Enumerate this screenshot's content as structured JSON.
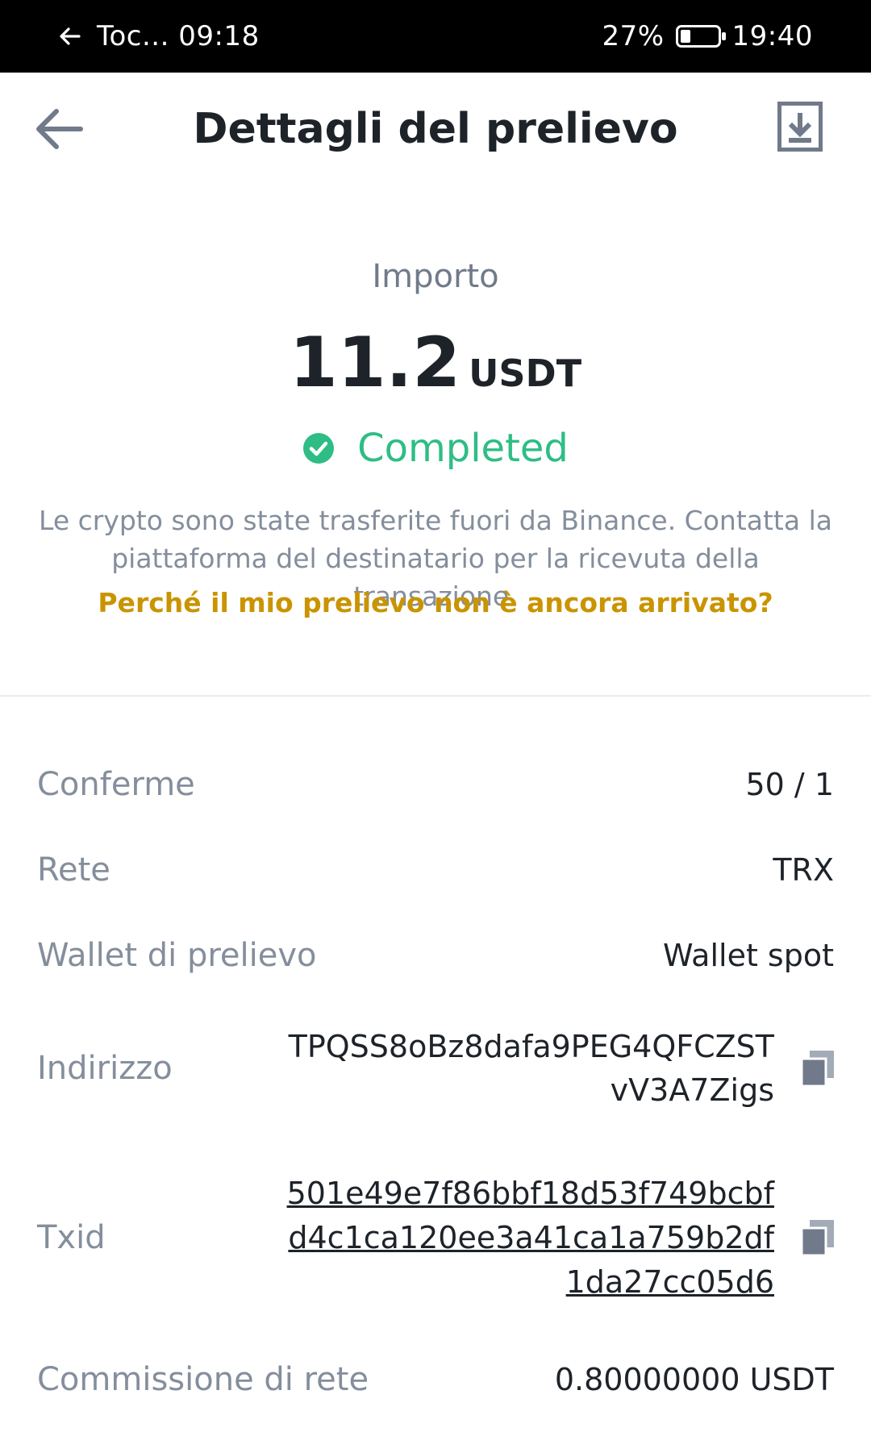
{
  "status_bar": {
    "left_text": "Toc... 09:18",
    "battery": "27%",
    "battery_level": 0.27,
    "time": "19:40"
  },
  "header": {
    "title": "Dettagli del prelievo"
  },
  "summary": {
    "amount_label": "Importo",
    "amount": "11.2",
    "currency": "USDT",
    "status": "Completed",
    "description": "Le crypto sono state trasferite fuori da Binance. Contatta la piattaforma del destinatario per la ricevuta della transazione.",
    "help_link": "Perché il mio prelievo non è ancora arrivato?"
  },
  "details": {
    "confirmations": {
      "label": "Conferme",
      "value": "50 / 1"
    },
    "network": {
      "label": "Rete",
      "value": "TRX"
    },
    "wallet": {
      "label": "Wallet di prelievo",
      "value": "Wallet spot"
    },
    "address": {
      "label": "Indirizzo",
      "line1": "TPQSS8oBz8dafa9PEG4QFCZST",
      "line2": "vV3A7Zigs"
    },
    "txid": {
      "label": "Txid",
      "line1": "501e49e7f86bbf18d53f749bcbf",
      "line2": "d4c1ca120ee3a41ca1a759b2df",
      "line3": "1da27cc05d6"
    },
    "fee": {
      "label": "Commissione di rete",
      "value": "0.80000000 USDT"
    }
  },
  "colors": {
    "success": "#2ebd85",
    "link": "#c99400",
    "label": "#848e9c",
    "text": "#1e2329"
  }
}
